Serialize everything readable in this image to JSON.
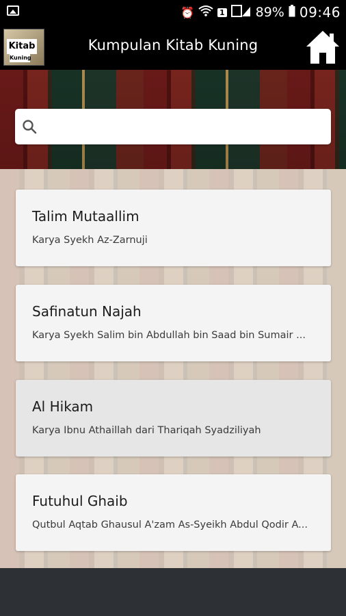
{
  "status_bar": {
    "battery": "89%",
    "time": "09:46",
    "sim_badge": "1"
  },
  "app_bar": {
    "logo": {
      "line1": "Kitab",
      "line2": "Kuning"
    },
    "title": "Kumpulan Kitab Kuning",
    "home_icon": "home-icon"
  },
  "search": {
    "placeholder": "",
    "icon": "search-icon"
  },
  "list": {
    "items": [
      {
        "title": "Talim Mutaallim",
        "subtitle": "Karya Syekh Az-Zarnuji"
      },
      {
        "title": "Safinatun Najah",
        "subtitle": "Karya Syekh Salim bin Abdullah bin Saad bin Sumair ..."
      },
      {
        "title": "Al Hikam",
        "subtitle": "Karya Ibnu Athaillah dari Thariqah Syadziliyah"
      },
      {
        "title": "Futuhul Ghaib",
        "subtitle": "Qutbul Aqtab Ghausul A'zam As-Syeikh Abdul Qodir A..."
      }
    ]
  },
  "colors": {
    "app_bar": "#000000",
    "card": "#f4f4f4",
    "card_selected": "#e6e6e6",
    "bottom_bar": "#2d3034"
  }
}
